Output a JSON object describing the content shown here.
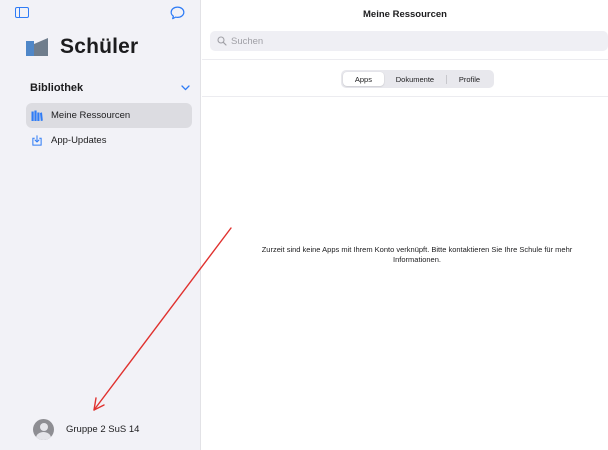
{
  "sidebar": {
    "app_title": "Schüler",
    "section_title": "Bibliothek",
    "items": [
      {
        "label": "Meine Ressourcen",
        "icon": "library-books-icon",
        "active": true
      },
      {
        "label": "App-Updates",
        "icon": "download-tray-icon",
        "active": false
      }
    ],
    "user": {
      "name": "Gruppe 2 SuS 14",
      "icon": "avatar-icon"
    }
  },
  "main": {
    "title": "Meine Ressourcen",
    "search": {
      "placeholder": "Suchen",
      "value": ""
    },
    "tabs": [
      {
        "label": "Apps",
        "selected": true
      },
      {
        "label": "Dokumente",
        "selected": false
      },
      {
        "label": "Profile",
        "selected": false
      }
    ],
    "empty_message_line1": "Zurzeit sind keine Apps mit Ihrem Konto verknüpft. Bitte kontaktieren Sie Ihre Schule für mehr",
    "empty_message_line2": "Informationen."
  },
  "colors": {
    "accent": "#2f7cf6",
    "sidebar_background": "#f2f2f7",
    "annotation_arrow": "#e0322f"
  }
}
